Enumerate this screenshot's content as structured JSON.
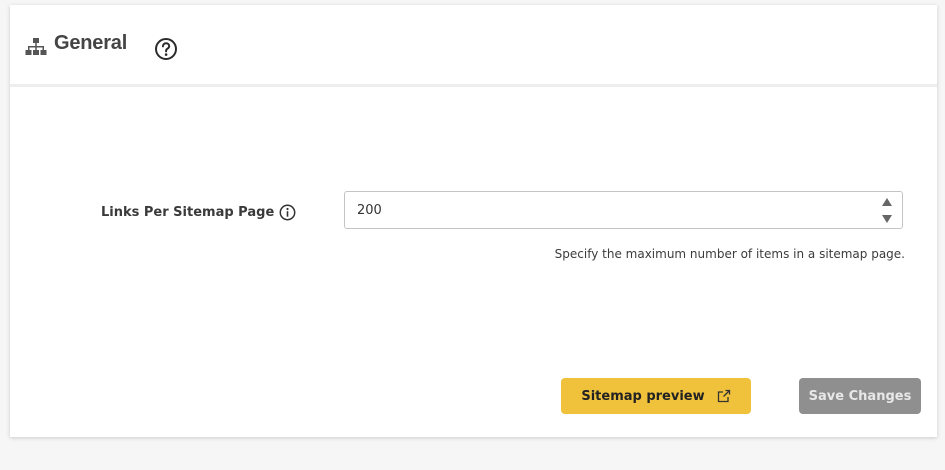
{
  "header": {
    "icon": "sitemap-icon",
    "title": "General",
    "help_icon": "question-circle-icon"
  },
  "field": {
    "label": "Links Per Sitemap Page",
    "info_icon": "info-circle-icon",
    "value": "200",
    "help_text": "Specify the maximum number of items in a sitemap page."
  },
  "actions": {
    "preview_label": "Sitemap preview",
    "preview_icon": "external-link-icon",
    "save_label": "Save Changes"
  },
  "colors": {
    "preview_button": "#f0c23c",
    "save_button_disabled": "#8f8f8f",
    "title_text": "#444444"
  }
}
